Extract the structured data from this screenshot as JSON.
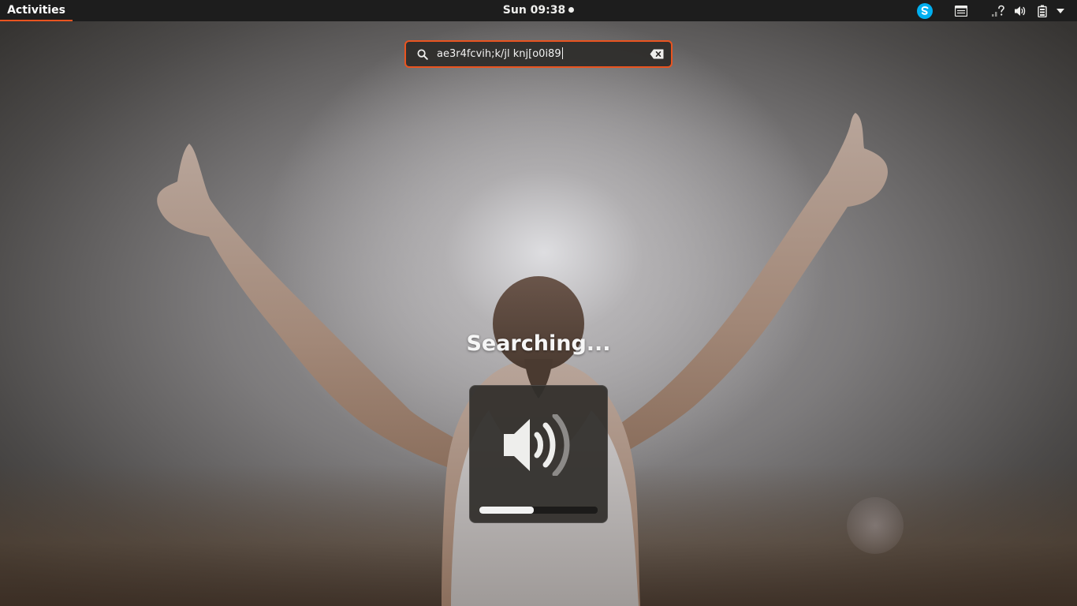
{
  "topbar": {
    "activities_label": "Activities",
    "clock": "Sun 09:38",
    "notification_indicator": "dot",
    "tray_icons": [
      "skype-icon",
      "notes-icon",
      "network-unknown-icon",
      "volume-icon",
      "battery-icon",
      "system-menu-arrow-icon"
    ]
  },
  "search": {
    "value": "ae3r4fcvih;k/jl knj[o0i89",
    "icon": "search-icon",
    "clear_icon": "clear-text-icon"
  },
  "status": {
    "text": "Searching..."
  },
  "volume_osd": {
    "icon": "speaker-volume-icon",
    "level_fraction": 0.46
  },
  "colors": {
    "accent": "#e95420",
    "topbar_bg": "#1d1d1d",
    "skype_blue": "#00aff0",
    "osd_bg": "#302e2b"
  }
}
